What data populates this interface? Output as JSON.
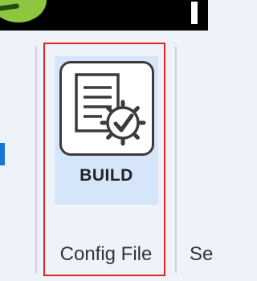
{
  "ribbon": {
    "build_button": {
      "label": "BUILD",
      "icon": "config-document-check-icon"
    },
    "group_label": "Config File",
    "next_group_label": "Se"
  },
  "colors": {
    "accent_green": "#8dc63f",
    "highlight_box": "#d9252c",
    "button_hover_bg": "#d5e5fa",
    "ribbon_bg": "#eef3fa",
    "topbar_bg": "#000000"
  }
}
